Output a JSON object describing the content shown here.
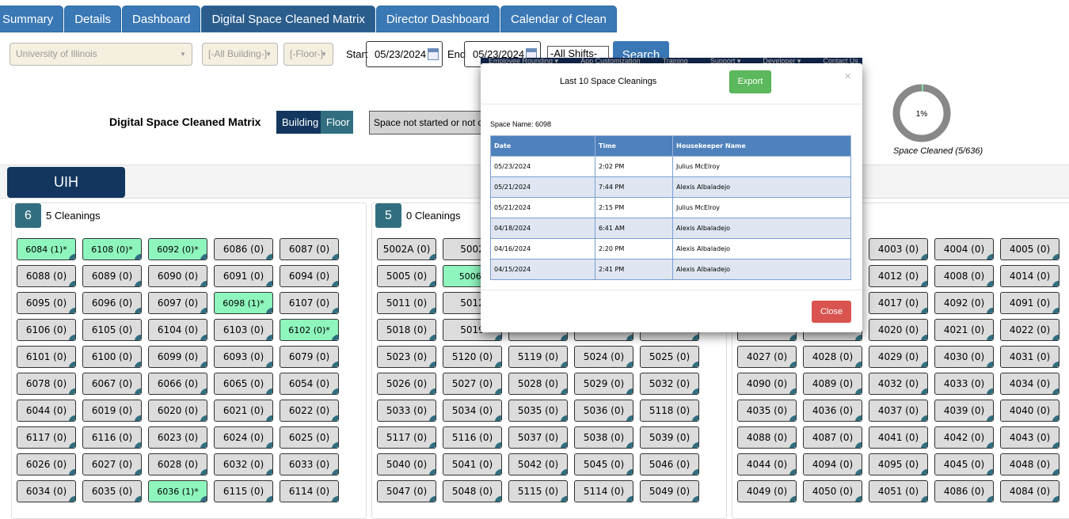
{
  "tabs": [
    "Summary",
    "Details",
    "Dashboard",
    "Digital Space Cleaned Matrix",
    "Director Dashboard",
    "Calendar of Clean"
  ],
  "filters": {
    "organization": "University of Illinois",
    "building": "[-All Building-]",
    "floor": "[-Floor-]",
    "start_label": "Start",
    "start": "05/23/2024",
    "end_label": "End",
    "end": "05/23/2024",
    "shift": "-All Shifts-",
    "search": "Search"
  },
  "matrix": {
    "title": "Digital Space Cleaned Matrix",
    "toggle_building": "Building",
    "toggle_floor": "Floor",
    "legend_text": "Space not started or not c"
  },
  "donut": {
    "percent_label": "1%",
    "percent": 1,
    "caption": "Space Cleaned (5/636)",
    "colors": {
      "cleaned": "#7de3a6",
      "remaining": "#888888"
    }
  },
  "building_name": "UIH",
  "nav_behind": [
    "Employee Rounding ▾",
    "App Customization",
    "Training",
    "Support ▾",
    "Developer ▾",
    "Contact Us"
  ],
  "floors": [
    {
      "num": "6",
      "count": "5 Cleanings",
      "rows": [
        [
          "6084 (1)*",
          "6108 (0)*",
          "6092 (0)*",
          "6086 (0)",
          "6087 (0)"
        ],
        [
          "6088 (0)",
          "6089 (0)",
          "6090 (0)",
          "6091 (0)",
          "6094 (0)"
        ],
        [
          "6095 (0)",
          "6096 (0)",
          "6097 (0)",
          "6098 (1)*",
          "6107 (0)"
        ],
        [
          "6106 (0)",
          "6105 (0)",
          "6104 (0)",
          "6103 (0)",
          "6102 (0)*"
        ],
        [
          "6101 (0)",
          "6100 (0)",
          "6099 (0)",
          "6093 (0)",
          "6079 (0)"
        ],
        [
          "6078 (0)",
          "6067 (0)",
          "6066 (0)",
          "6065 (0)",
          "6054 (0)"
        ],
        [
          "6044 (0)",
          "6019 (0)",
          "6020 (0)",
          "6021 (0)",
          "6022 (0)"
        ],
        [
          "6117 (0)",
          "6116 (0)",
          "6023 (0)",
          "6024 (0)",
          "6025 (0)"
        ],
        [
          "6026 (0)",
          "6027 (0)",
          "6028 (0)",
          "6032 (0)",
          "6033 (0)"
        ],
        [
          "6034 (0)",
          "6035 (0)",
          "6036 (1)*",
          "6115 (0)",
          "6114 (0)"
        ]
      ]
    },
    {
      "num": "5",
      "count": "0 Cleanings",
      "rows": [
        [
          "5002A (0)",
          "5002",
          null,
          null,
          null
        ],
        [
          "5005 (0)",
          "5006*",
          null,
          null,
          null
        ],
        [
          "5011 (0)",
          "5012",
          null,
          null,
          null
        ],
        [
          "5018 (0)",
          "5019",
          null,
          null,
          null
        ],
        [
          "5023 (0)",
          "5120 (0)",
          "5119 (0)",
          "5024 (0)",
          "5025 (0)"
        ],
        [
          "5026 (0)",
          "5027 (0)",
          "5028 (0)",
          "5029 (0)",
          "5032 (0)"
        ],
        [
          "5033 (0)",
          "5034 (0)",
          "5035 (0)",
          "5036 (0)",
          "5118 (0)"
        ],
        [
          "5117 (0)",
          "5116 (0)",
          "5037 (0)",
          "5038 (0)",
          "5039 (0)"
        ],
        [
          "5040 (0)",
          "5041 (0)",
          "5042 (0)",
          "5045 (0)",
          "5046 (0)"
        ],
        [
          "5047 (0)",
          "5048 (0)",
          "5115 (0)",
          "5114 (0)",
          "5049 (0)"
        ]
      ]
    },
    {
      "num": "",
      "count": "",
      "rows": [
        [
          null,
          null,
          "4003 (0)",
          "4004 (0)",
          "4005 (0)"
        ],
        [
          null,
          null,
          "4012 (0)",
          "4008 (0)",
          "4014 (0)"
        ],
        [
          null,
          null,
          "4017 (0)",
          "4092 (0)",
          "4091 (0)"
        ],
        [
          null,
          null,
          "4020 (0)",
          "4021 (0)",
          "4022 (0)"
        ],
        [
          "4027 (0)",
          "4028 (0)",
          "4029 (0)",
          "4030 (0)",
          "4031 (0)"
        ],
        [
          "4090 (0)",
          "4089 (0)",
          "4032 (0)",
          "4033 (0)",
          "4034 (0)"
        ],
        [
          "4035 (0)",
          "4036 (0)",
          "4037 (0)",
          "4039 (0)",
          "4040 (0)"
        ],
        [
          "4088 (0)",
          "4087 (0)",
          "4041 (0)",
          "4042 (0)",
          "4043 (0)"
        ],
        [
          "4044 (0)",
          "4094 (0)",
          "4095 (0)",
          "4045 (0)",
          "4048 (0)"
        ],
        [
          "4049 (0)",
          "4050 (0)",
          "4051 (0)",
          "4086 (0)",
          "4084 (0)"
        ]
      ]
    }
  ],
  "modal": {
    "title": "Last 10 Space Cleanings",
    "export": "Export",
    "close_x": "×",
    "space_name": "Space Name: 6098",
    "columns": [
      "Date",
      "Time",
      "Housekeeper Name"
    ],
    "rows": [
      [
        "05/23/2024",
        "2:02 PM",
        "Julius McElroy"
      ],
      [
        "05/21/2024",
        "7:44 PM",
        "Alexis Albaladejo"
      ],
      [
        "05/21/2024",
        "2:15 PM",
        "Julius McElroy"
      ],
      [
        "04/18/2024",
        "6:41 AM",
        "Alexis Albaladejo"
      ],
      [
        "04/16/2024",
        "2:20 PM",
        "Alexis Albaladejo"
      ],
      [
        "04/15/2024",
        "2:41 PM",
        "Alexis Albaladejo"
      ]
    ],
    "close": "Close"
  }
}
